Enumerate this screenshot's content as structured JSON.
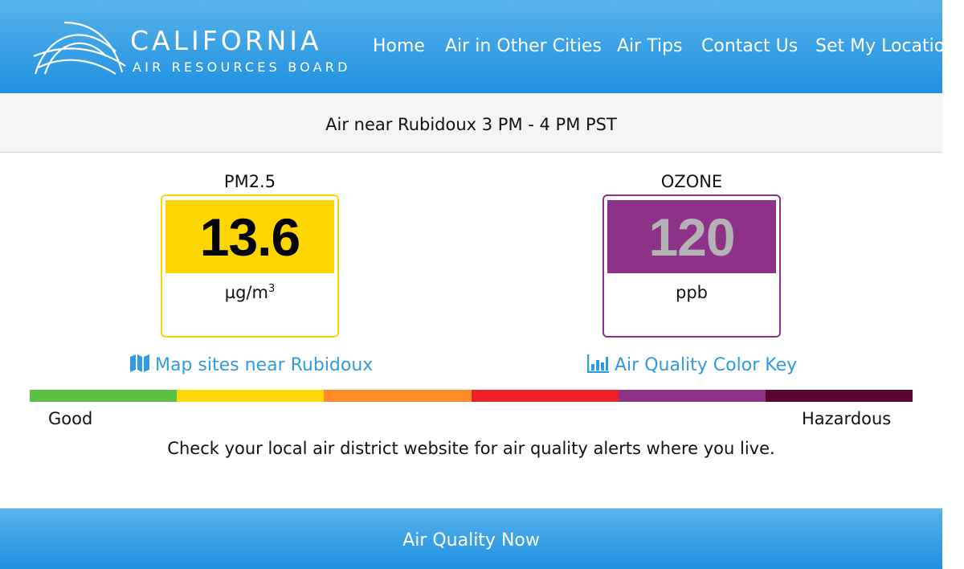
{
  "header": {
    "logo_title": "CALIFORNIA",
    "logo_subtitle": "AIR RESOURCES BOARD",
    "nav": [
      "Home",
      "Air in Other Cities",
      "Air Tips",
      "Contact Us",
      "Set My Location"
    ]
  },
  "subheader": {
    "text": "Air near Rubidoux 3 PM - 4 PM PST"
  },
  "pm25": {
    "label": "PM2.5",
    "value": "13.6",
    "unit_base": "µg/m",
    "unit_exp": "3",
    "color": "#ffd500",
    "text_color": "#000000"
  },
  "ozone": {
    "label": "OZONE",
    "value": "120",
    "unit": "ppb",
    "color": "#8e3189",
    "text_color": "#b3b3b3"
  },
  "links": {
    "map": "Map sites near Rubidoux",
    "map_icon": "map-icon",
    "color_key": "Air Quality Color Key",
    "color_key_icon": "bar-chart-icon"
  },
  "scale": {
    "colors": [
      "#5cc146",
      "#ffd80a",
      "#ff8c2a",
      "#f02027",
      "#8e3189",
      "#56062f"
    ],
    "low_label": "Good",
    "high_label": "Hazardous"
  },
  "notice": "Check your local air district website for air quality alerts where you live.",
  "footer": {
    "text": "Air Quality Now"
  }
}
